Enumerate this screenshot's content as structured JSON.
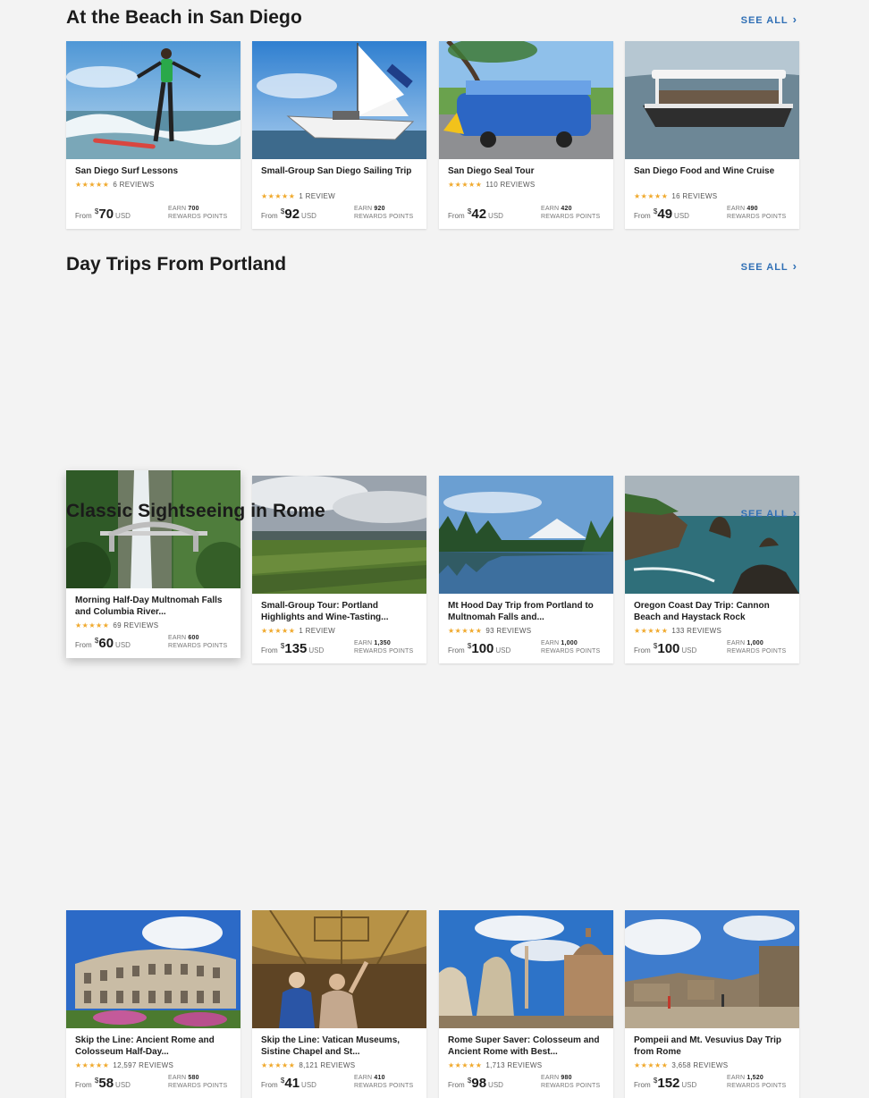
{
  "labels": {
    "see_all": "SEE ALL",
    "from": "From",
    "dollar": "$",
    "usd": "USD",
    "earn": "EARN",
    "rewards": "REWARDS POINTS"
  },
  "sections": [
    {
      "title": "At the Beach in San Diego",
      "cards": [
        {
          "title": "San Diego Surf Lessons",
          "reviews": "6 REVIEWS",
          "stars": "★★★★★",
          "price": "70",
          "points": "700"
        },
        {
          "title": "Small-Group San Diego Sailing Trip",
          "reviews": "1 REVIEW",
          "stars": "★★★★★",
          "price": "92",
          "points": "920"
        },
        {
          "title": "San Diego Seal Tour",
          "reviews": "110 REVIEWS",
          "stars": "★★★★★",
          "price": "42",
          "points": "420"
        },
        {
          "title": "San Diego Food and Wine Cruise",
          "reviews": "16 REVIEWS",
          "stars": "★★★★★",
          "price": "49",
          "points": "490"
        }
      ]
    },
    {
      "title": "Day Trips From Portland",
      "cards": [
        {
          "title": "Morning Half-Day Multnomah Falls and Columbia River...",
          "reviews": "69 REVIEWS",
          "stars": "★★★★★",
          "price": "60",
          "points": "600"
        },
        {
          "title": "Small-Group Tour: Portland Highlights and Wine-Tasting...",
          "reviews": "1 REVIEW",
          "stars": "★★★★★",
          "price": "135",
          "points": "1,350"
        },
        {
          "title": "Mt Hood Day Trip from Portland to Multnomah Falls and...",
          "reviews": "93 REVIEWS",
          "stars": "★★★★★",
          "price": "100",
          "points": "1,000"
        },
        {
          "title": "Oregon Coast Day Trip: Cannon Beach and Haystack Rock",
          "reviews": "133 REVIEWS",
          "stars": "★★★★★",
          "price": "100",
          "points": "1,000"
        }
      ]
    },
    {
      "title": "Classic Sightseeing in Rome",
      "cards": [
        {
          "title": "Skip the Line: Ancient Rome and Colosseum Half-Day...",
          "reviews": "12,597 REVIEWS",
          "stars": "★★★★★",
          "price": "58",
          "points": "580"
        },
        {
          "title": "Skip the Line: Vatican Museums, Sistine Chapel and St...",
          "reviews": "8,121 REVIEWS",
          "stars": "★★★★★",
          "price": "41",
          "points": "410"
        },
        {
          "title": "Rome Super Saver: Colosseum and Ancient Rome with Best...",
          "reviews": "1,713 REVIEWS",
          "stars": "★★★★★",
          "price": "98",
          "points": "980"
        },
        {
          "title": "Pompeii and Mt. Vesuvius Day Trip from Rome",
          "reviews": "3,658 REVIEWS",
          "stars": "★★★★★",
          "price": "152",
          "points": "1,520"
        }
      ]
    }
  ]
}
